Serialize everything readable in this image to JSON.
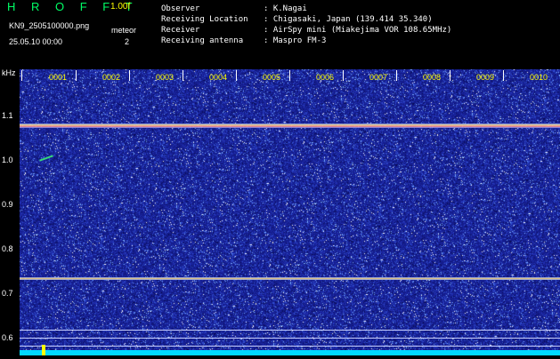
{
  "header": {
    "app_name": "H R O F F T",
    "version": "1.00f",
    "filename": "KN9_2505100000.png",
    "meteor_label": "meteor",
    "datetime": "25.05.10 00:00",
    "meteor_count": "2",
    "observer_label": "Observer",
    "observer_value": ": K.Nagai",
    "location_label": "Receiving Location",
    "location_value": ": Chigasaki, Japan (139.414 35.340)",
    "receiver_label": "Receiver",
    "receiver_value": ": AirSpy mini (Miakejima VOR 108.65MHz)",
    "antenna_label": "Receiving antenna",
    "antenna_value": ": Maspro FM-3"
  },
  "axis": {
    "y_unit": "kHz",
    "y_ticks": [
      "1.1",
      "1.0",
      "0.9",
      "0.8",
      "0.7",
      "0.6"
    ],
    "x_ticks": [
      "0001",
      "0002",
      "0003",
      "0004",
      "0005",
      "0006",
      "0007",
      "0008",
      "0009",
      "0010"
    ]
  },
  "colors": {
    "background": "#161d8f",
    "noise_low": "#2a3cc8",
    "noise_high": "#ffffff",
    "carrier": "#ffdd66",
    "baseline": "#00e5ff",
    "marker": "#ffff00",
    "title": "#00ff66"
  }
}
